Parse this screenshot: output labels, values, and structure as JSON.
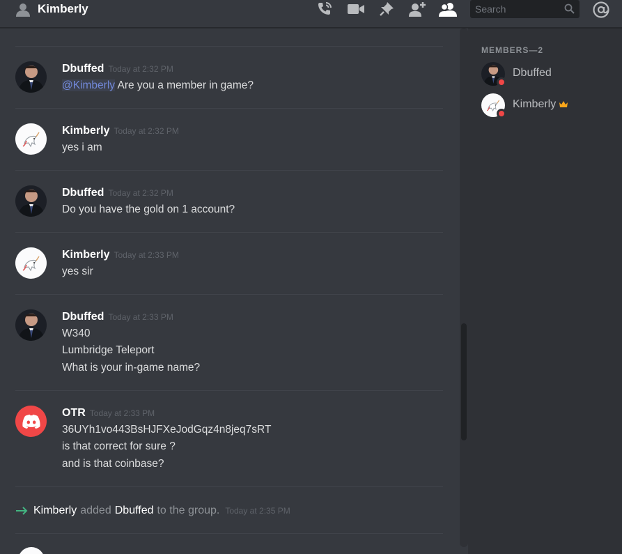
{
  "header": {
    "title": "Kimberly",
    "search_placeholder": "Search",
    "icons": [
      "person-icon",
      "call-icon",
      "video-icon",
      "pin-icon",
      "add-friend-icon",
      "member-list-icon",
      "search-icon",
      "mention-icon"
    ]
  },
  "messages": [
    {
      "author": "Dbuffed",
      "timestamp": "Today at 2:32 PM",
      "mention": "@Kimberly",
      "lines": [
        "Are you a member in game?"
      ]
    },
    {
      "author": "Kimberly",
      "timestamp": "Today at 2:32 PM",
      "lines": [
        "yes i am"
      ]
    },
    {
      "author": "Dbuffed",
      "timestamp": "Today at 2:32 PM",
      "lines": [
        "Do you have the gold on 1 account?"
      ]
    },
    {
      "author": "Kimberly",
      "timestamp": "Today at 2:33 PM",
      "lines": [
        "yes sir"
      ]
    },
    {
      "author": "Dbuffed",
      "timestamp": "Today at 2:33 PM",
      "lines": [
        "W340",
        "Lumbridge Teleport",
        "What is your in-game name?"
      ]
    },
    {
      "author": "OTR",
      "timestamp": "Today at 2:33 PM",
      "lines": [
        "36UYh1vo443BsHJFXeJodGqz4n8jeq7sRT",
        "is that correct for sure ?",
        "and is that coinbase?"
      ]
    }
  ],
  "system_message": {
    "actor": "Kimberly",
    "verb": "added",
    "target": "Dbuffed",
    "suffix": "to the group.",
    "timestamp": "Today at 2:35 PM"
  },
  "members": {
    "title": "MEMBERS—2",
    "list": [
      {
        "name": "Dbuffed",
        "status": "dnd"
      },
      {
        "name": "Kimberly",
        "status": "dnd",
        "owner": true
      }
    ]
  },
  "colors": {
    "background": "#36393f",
    "sidebar": "#2f3136",
    "mention": "#7289da",
    "dnd": "#f04747",
    "otr_avatar": "#f04747",
    "join_arrow": "#43b581",
    "crown": "#faa61a"
  }
}
